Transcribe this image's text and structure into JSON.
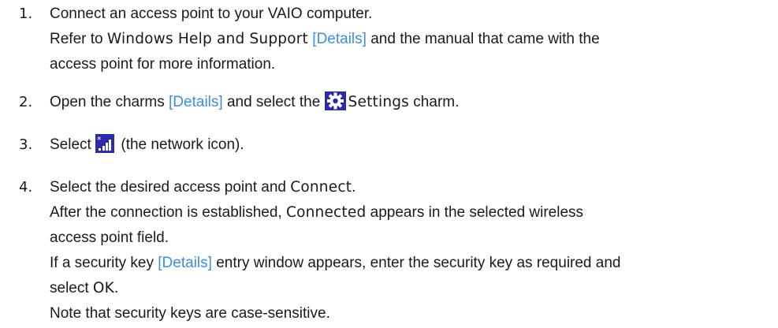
{
  "steps": [
    {
      "number": "1.",
      "line1": "Connect an access point to your VAIO computer.",
      "line2_a": "Refer to ",
      "line2_ui": "Windows Help and Support",
      "line2_link": "[Details]",
      "line2_b": " and the manual that came with the",
      "line3": "access point for more information."
    },
    {
      "number": "2.",
      "a": "Open the charms ",
      "link": "[Details]",
      "b": " and select the ",
      "icon": "gear-icon",
      "ui": "Settings",
      "c": " charm."
    },
    {
      "number": "3.",
      "a": "Select ",
      "icon": "network-signal-icon",
      "b": " (the network icon)."
    },
    {
      "number": "4.",
      "line1_a": "Select the desired access point and ",
      "line1_ui": "Connect",
      "line1_b": ".",
      "line2_a": "After the connection is established, ",
      "line2_ui": "Connected",
      "line2_b": " appears in the selected wireless",
      "line3": "access point field.",
      "line4_a": "If a security key ",
      "line4_link": "[Details]",
      "line4_b": " entry window appears, enter the security key as required and",
      "line5_a": "select ",
      "line5_ui": "OK",
      "line5_b": ".",
      "line6": "Note that security keys are case-sensitive."
    }
  ],
  "colors": {
    "text": "#1a1a1a",
    "link": "#3e8ede",
    "icon_bg": "#2b2ba6"
  }
}
